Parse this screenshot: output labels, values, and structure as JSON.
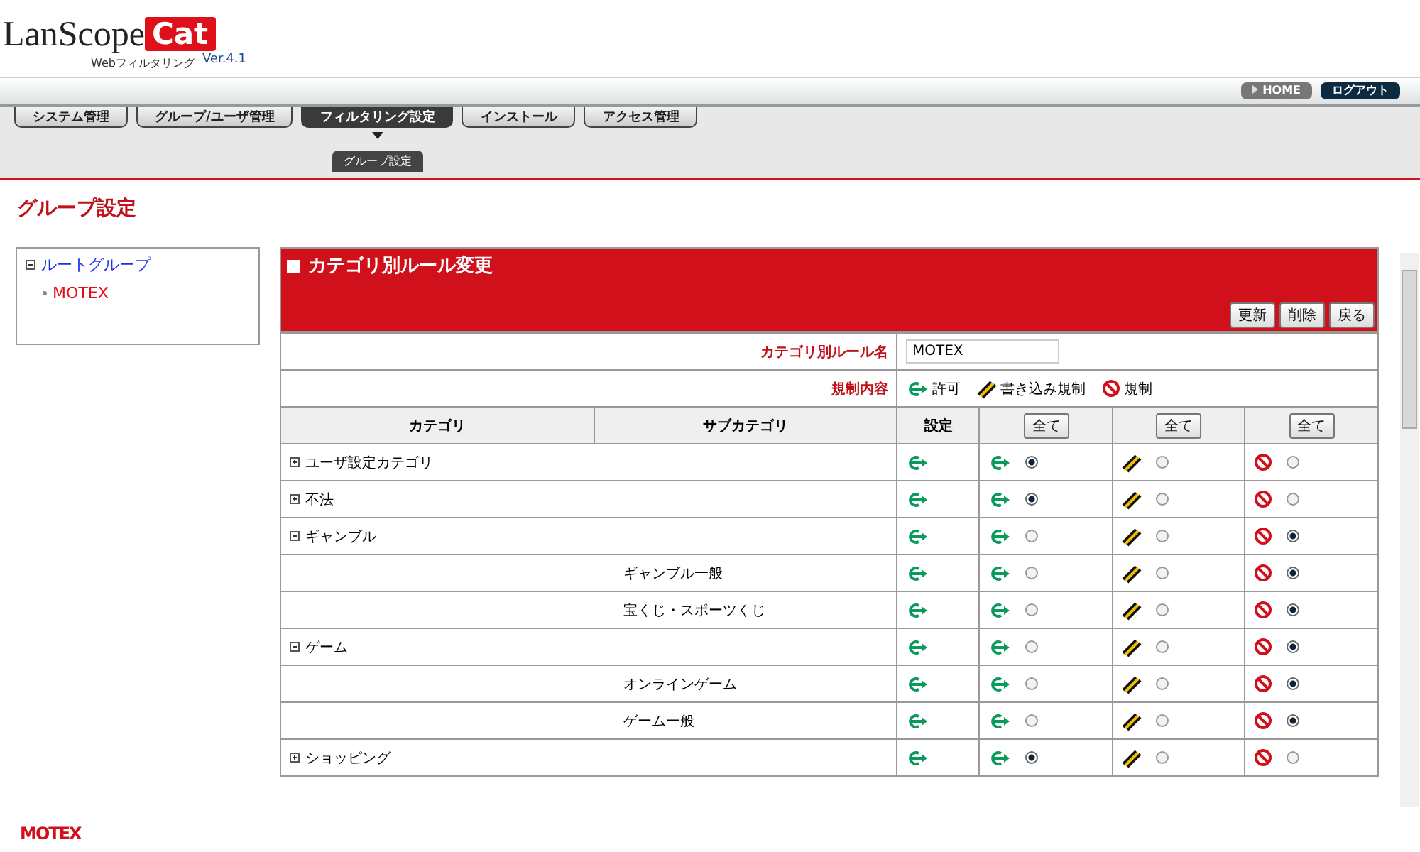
{
  "logo": {
    "name": "LanScope",
    "badge": "Cat",
    "product": "Webフィルタリング",
    "version": "Ver.4.1"
  },
  "top_links": [
    {
      "label": "HOME",
      "kind": "home"
    },
    {
      "label": "ログアウト",
      "kind": "logout"
    }
  ],
  "tabs": [
    {
      "label": "システム管理",
      "selected": false
    },
    {
      "label": "グループ/ユーザ管理",
      "selected": false
    },
    {
      "label": "フィルタリング設定",
      "selected": true
    },
    {
      "label": "インストール",
      "selected": false
    },
    {
      "label": "アクセス管理",
      "selected": false
    }
  ],
  "subtabs": [
    {
      "label": "グループ設定",
      "selected": true
    }
  ],
  "page_title": "グループ設定",
  "tree": [
    {
      "label": "ルートグループ",
      "expanded": true,
      "selected": false,
      "children": [
        {
          "label": "MOTEX",
          "selected": true
        }
      ]
    }
  ],
  "panel": {
    "title": "カテゴリ別ルール変更",
    "buttons": [
      "更新",
      "削除",
      "戻る"
    ],
    "rule_name": {
      "label": "カテゴリ別ルール名",
      "value": "MOTEX"
    },
    "legend": {
      "label": "規制内容",
      "items": [
        {
          "kind": "allow",
          "label": "許可"
        },
        {
          "kind": "write",
          "label": "書き込み規制"
        },
        {
          "kind": "block",
          "label": "規制"
        }
      ]
    },
    "columns": [
      "カテゴリ",
      "サブカテゴリ",
      "設定"
    ],
    "all_buttons": [
      "全て",
      "全て",
      "全て"
    ],
    "rows": [
      {
        "category": "ユーザ設定カテゴリ",
        "expanded": false,
        "setting": {
          "kind": "allow"
        },
        "options": [
          {
            "selected": true
          },
          {
            "selected": false
          },
          {
            "selected": false
          }
        ]
      },
      {
        "category": "不法",
        "expanded": false,
        "setting": {
          "kind": "allow"
        },
        "options": [
          {
            "selected": true
          },
          {
            "selected": false
          },
          {
            "selected": false
          }
        ]
      },
      {
        "category": "ギャンブル",
        "expanded": true,
        "setting": {
          "kind": "allow"
        },
        "options": [
          {
            "selected": false
          },
          {
            "selected": false
          },
          {
            "selected": true
          }
        ],
        "children": [
          {
            "subcategory": "ギャンブル一般",
            "setting": {
              "kind": "allow"
            },
            "options": [
              {
                "selected": false
              },
              {
                "selected": false
              },
              {
                "selected": true
              }
            ]
          },
          {
            "subcategory": "宝くじ・スポーツくじ",
            "setting": {
              "kind": "allow"
            },
            "options": [
              {
                "selected": false
              },
              {
                "selected": false
              },
              {
                "selected": true
              }
            ]
          }
        ]
      },
      {
        "category": "ゲーム",
        "expanded": true,
        "setting": {
          "kind": "allow"
        },
        "options": [
          {
            "selected": false
          },
          {
            "selected": false
          },
          {
            "selected": true
          }
        ],
        "children": [
          {
            "subcategory": "オンラインゲーム",
            "setting": {
              "kind": "allow"
            },
            "options": [
              {
                "selected": false
              },
              {
                "selected": false
              },
              {
                "selected": true
              }
            ]
          },
          {
            "subcategory": "ゲーム一般",
            "setting": {
              "kind": "allow"
            },
            "options": [
              {
                "selected": false
              },
              {
                "selected": false
              },
              {
                "selected": true
              }
            ]
          }
        ]
      },
      {
        "category": "ショッピング",
        "expanded": false,
        "setting": {
          "kind": "allow"
        },
        "options": [
          {
            "selected": true
          },
          {
            "selected": false
          },
          {
            "selected": false
          }
        ]
      }
    ]
  },
  "footer": "MOTEX"
}
